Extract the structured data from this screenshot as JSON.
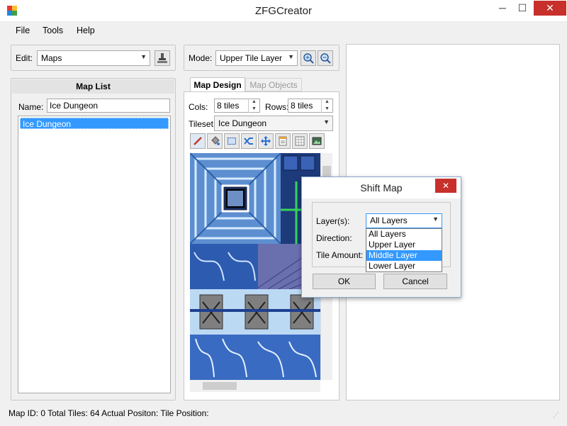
{
  "window": {
    "title": "ZFGCreator",
    "minimize": "─",
    "maximize": "☐",
    "close": "✕"
  },
  "menu": {
    "file": "File",
    "tools": "Tools",
    "help": "Help"
  },
  "edit": {
    "label": "Edit:",
    "value": "Maps"
  },
  "mode": {
    "label": "Mode:",
    "value": "Upper Tile Layer"
  },
  "map_list": {
    "title": "Map List",
    "name_label": "Name:",
    "name_value": "Ice Dungeon",
    "items": [
      "Ice Dungeon"
    ]
  },
  "tabs": {
    "design": "Map Design",
    "objects": "Map Objects"
  },
  "design": {
    "cols_label": "Cols:",
    "cols_value": "8 tiles",
    "rows_label": "Rows:",
    "rows_value": "8 tiles",
    "tileset_label": "Tileset:",
    "tileset_value": "Ice Dungeon"
  },
  "toolbar_icons": [
    "pencil-icon",
    "fill-bucket-icon",
    "select-rect-icon",
    "shuffle-icon",
    "move-arrows-icon",
    "document-icon",
    "grid-icon",
    "image-icon"
  ],
  "dialog": {
    "title": "Shift Map",
    "close": "✕",
    "layers_label": "Layer(s):",
    "layers_value": "All Layers",
    "direction_label": "Direction:",
    "tile_amount_label": "Tile Amount:",
    "options": [
      "All Layers",
      "Upper Layer",
      "Middle Layer",
      "Lower Layer"
    ],
    "ok": "OK",
    "cancel": "Cancel"
  },
  "status": {
    "text": "Map ID: 0 Total Tiles: 64 Actual Positon:  Tile Position:"
  },
  "colors": {
    "selection": "#3399ff",
    "close_red": "#c7302b",
    "tile_blue": "#8fb6e6"
  }
}
